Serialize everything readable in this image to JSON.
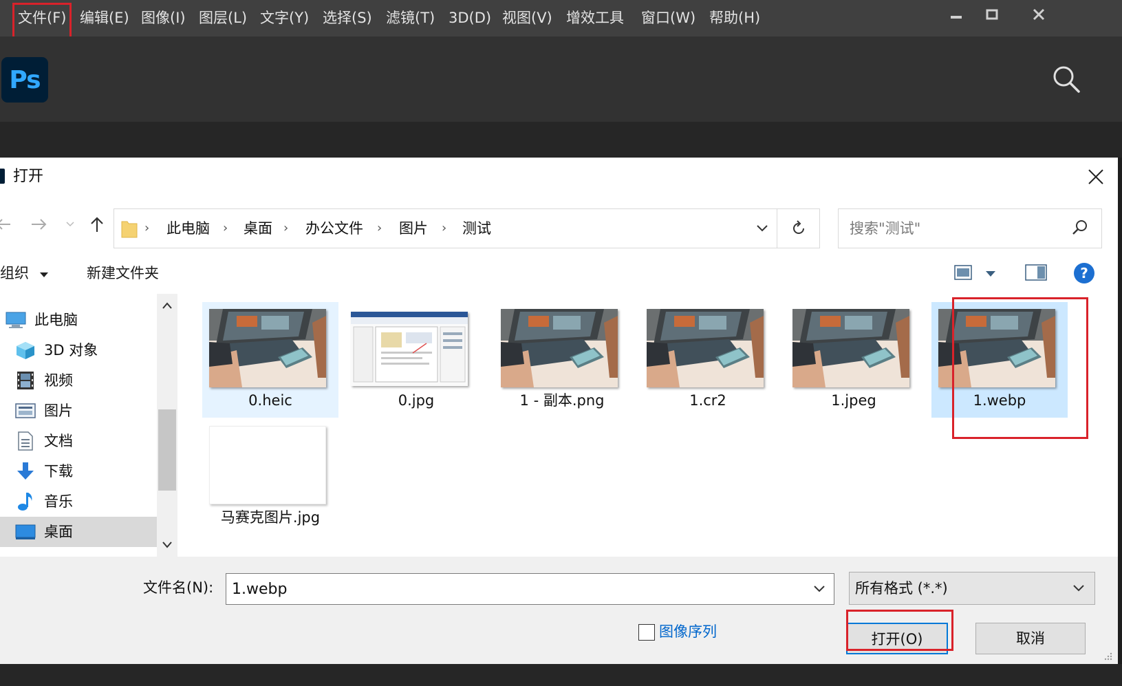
{
  "menubar": {
    "items": [
      "文件(F)",
      "编辑(E)",
      "图像(I)",
      "图层(L)",
      "文字(Y)",
      "选择(S)",
      "滤镜(T)",
      "3D(D)",
      "视图(V)",
      "增效工具",
      "窗口(W)",
      "帮助(H)"
    ]
  },
  "app": {
    "logo": "Ps"
  },
  "dialog": {
    "title": "打开",
    "breadcrumbs": [
      "此电脑",
      "桌面",
      "办公文件",
      "图片",
      "测试"
    ],
    "search_placeholder": "搜索\"测试\"",
    "toolbar": {
      "organize": "组织",
      "new_folder": "新建文件夹"
    },
    "nav_items": [
      {
        "label": "此电脑",
        "icon": "computer-icon"
      },
      {
        "label": "3D 对象",
        "icon": "cube-icon"
      },
      {
        "label": "视频",
        "icon": "film-icon"
      },
      {
        "label": "图片",
        "icon": "picture-icon"
      },
      {
        "label": "文档",
        "icon": "document-icon"
      },
      {
        "label": "下载",
        "icon": "download-icon"
      },
      {
        "label": "音乐",
        "icon": "music-icon"
      },
      {
        "label": "桌面",
        "icon": "desktop-icon"
      }
    ],
    "files": [
      {
        "name": "0.heic",
        "thumb": "photo-laptop"
      },
      {
        "name": "0.jpg",
        "thumb": "screenshot-ui"
      },
      {
        "name": "1 - 副本.png",
        "thumb": "photo-laptop"
      },
      {
        "name": "1.cr2",
        "thumb": "photo-laptop"
      },
      {
        "name": "1.jpeg",
        "thumb": "photo-laptop"
      },
      {
        "name": "1.webp",
        "thumb": "photo-laptop"
      },
      {
        "name": "马赛克图片.jpg",
        "thumb": "blank"
      }
    ],
    "filename_label": "文件名(N):",
    "filename_value": "1.webp",
    "filetype": "所有格式 (*.*)",
    "image_sequence": "图像序列",
    "open_button": "打开(O)",
    "cancel_button": "取消"
  },
  "colors": {
    "highlight": "#d9222a",
    "selection": "#cce8ff",
    "ps_blue": "#31a8ff"
  }
}
